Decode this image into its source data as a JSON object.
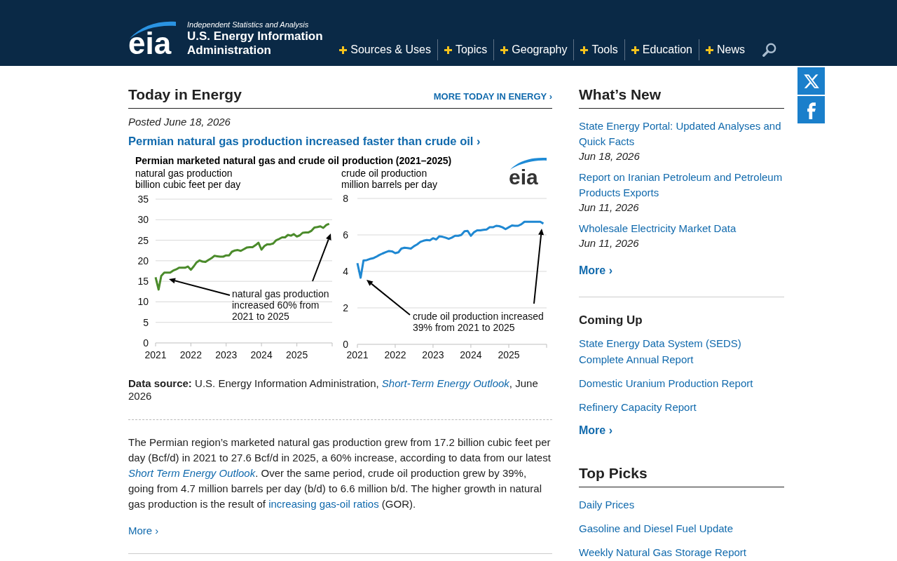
{
  "header": {
    "logo": "eia",
    "tagline": "Independent Statistics and Analysis",
    "org_name": [
      "U.S. Energy Information",
      "Administration"
    ],
    "nav": [
      {
        "label": "Sources & Uses"
      },
      {
        "label": "Topics"
      },
      {
        "label": "Geography"
      },
      {
        "label": "Tools"
      },
      {
        "label": "Education"
      },
      {
        "label": "News"
      }
    ]
  },
  "today": {
    "heading": "Today in Energy",
    "more_link": "MORE TODAY IN ENERGY ›",
    "posted": "Posted June 18, 2026",
    "headline": "Permian natural gas production increased faster than crude oil ›",
    "figure": {
      "title": "Permian marketed natural gas and crude oil production (2021–2025)",
      "logo": "eia",
      "chart_data": [
        {
          "type": "line",
          "ylabel": "natural gas production\nbillion cubic feet per day",
          "x": [
            "2021-01-01",
            "2021-02-01",
            "2021-03-01",
            "2021-04-01",
            "2021-05-01",
            "2021-06-01",
            "2021-07-01",
            "2021-08-01",
            "2021-09-01",
            "2021-10-01",
            "2021-11-01",
            "2021-12-01",
            "2022-01-01",
            "2022-02-01",
            "2022-03-01",
            "2022-04-01",
            "2022-05-01",
            "2022-06-01",
            "2022-07-01",
            "2022-08-01",
            "2022-09-01",
            "2022-10-01",
            "2022-11-01",
            "2022-12-01",
            "2023-01-01",
            "2023-02-01",
            "2023-03-01",
            "2023-04-01",
            "2023-05-01",
            "2023-06-01",
            "2023-07-01",
            "2023-08-01",
            "2023-09-01",
            "2023-10-01",
            "2023-11-01",
            "2023-12-01",
            "2024-01-01",
            "2024-02-01",
            "2024-03-01",
            "2024-04-01",
            "2024-05-01",
            "2024-06-01",
            "2024-07-01",
            "2024-08-01",
            "2024-09-01",
            "2024-10-01",
            "2024-11-01",
            "2024-12-01",
            "2025-01-01",
            "2025-02-01",
            "2025-03-01",
            "2025-04-01",
            "2025-05-01",
            "2025-06-01",
            "2025-07-01",
            "2025-08-01",
            "2025-09-01",
            "2025-10-01",
            "2025-11-01",
            "2025-12-01"
          ],
          "values": [
            16.0,
            13.0,
            16.3,
            17.1,
            17.1,
            17.1,
            17.6,
            17.9,
            18.3,
            18.3,
            18.3,
            18.6,
            17.8,
            18.7,
            19.6,
            20.1,
            19.8,
            19.7,
            20.2,
            20.6,
            21.2,
            21.1,
            21.0,
            21.0,
            21.3,
            21.3,
            22.2,
            22.5,
            22.6,
            22.4,
            22.8,
            23.2,
            23.3,
            23.3,
            23.8,
            24.4,
            22.7,
            23.6,
            24.0,
            24.0,
            24.2,
            25.0,
            25.3,
            25.7,
            25.7,
            26.3,
            26.1,
            26.5,
            25.9,
            26.2,
            26.8,
            26.9,
            26.9,
            27.3,
            28.1,
            28.2,
            28.4,
            28.0,
            28.7,
            29.0
          ],
          "color": "#4b8b2b",
          "xlim": [
            "2021-01-01",
            "2026-01-01"
          ],
          "ylim": [
            0,
            35
          ],
          "yticks": [
            0,
            5,
            10,
            15,
            20,
            25,
            30,
            35
          ],
          "xticks": [
            {
              "value": "2021-01-01",
              "label": "2021"
            },
            {
              "value": "2022-01-01",
              "label": "2022"
            },
            {
              "value": "2023-01-01",
              "label": "2023"
            },
            {
              "value": "2024-01-01",
              "label": "2024"
            },
            {
              "value": "2025-01-01",
              "label": "2025"
            }
          ],
          "grid": "y",
          "annotations": [
            "natural gas production\nincreased 60% from\n2021 to 2025"
          ]
        },
        {
          "type": "line",
          "ylabel": "crude oil production\nmillion barrels per day",
          "x": [
            "2021-01-01",
            "2021-02-01",
            "2021-03-01",
            "2021-04-01",
            "2021-05-01",
            "2021-06-01",
            "2021-07-01",
            "2021-08-01",
            "2021-09-01",
            "2021-10-01",
            "2021-11-01",
            "2021-12-01",
            "2022-01-01",
            "2022-02-01",
            "2022-03-01",
            "2022-04-01",
            "2022-05-01",
            "2022-06-01",
            "2022-07-01",
            "2022-08-01",
            "2022-09-01",
            "2022-10-01",
            "2022-11-01",
            "2022-12-01",
            "2023-01-01",
            "2023-02-01",
            "2023-03-01",
            "2023-04-01",
            "2023-05-01",
            "2023-06-01",
            "2023-07-01",
            "2023-08-01",
            "2023-09-01",
            "2023-10-01",
            "2023-11-01",
            "2023-12-01",
            "2024-01-01",
            "2024-02-01",
            "2024-03-01",
            "2024-04-01",
            "2024-05-01",
            "2024-06-01",
            "2024-07-01",
            "2024-08-01",
            "2024-09-01",
            "2024-10-01",
            "2024-11-01",
            "2024-12-01",
            "2025-01-01",
            "2025-02-01",
            "2025-03-01",
            "2025-04-01",
            "2025-05-01",
            "2025-06-01",
            "2025-07-01",
            "2025-08-01",
            "2025-09-01",
            "2025-10-01",
            "2025-11-01",
            "2025-12-01"
          ],
          "values": [
            4.45,
            3.65,
            4.6,
            4.62,
            4.68,
            4.72,
            4.8,
            4.9,
            4.98,
            5.05,
            5.12,
            5.1,
            5.0,
            5.05,
            5.25,
            5.3,
            5.28,
            5.25,
            5.38,
            5.48,
            5.62,
            5.68,
            5.72,
            5.7,
            5.82,
            5.75,
            5.92,
            5.9,
            5.85,
            5.78,
            5.85,
            5.95,
            5.95,
            6.0,
            6.2,
            6.22,
            5.95,
            6.15,
            6.25,
            6.25,
            6.28,
            6.3,
            6.42,
            6.42,
            6.5,
            6.48,
            6.42,
            6.32,
            6.42,
            6.52,
            6.5,
            6.5,
            6.58,
            6.72,
            6.72,
            6.72,
            6.72,
            6.72,
            6.72,
            6.62
          ],
          "color": "#1f88d2",
          "xlim": [
            "2021-01-01",
            "2026-01-01"
          ],
          "ylim": [
            0,
            8
          ],
          "yticks": [
            0,
            2,
            4,
            6,
            8
          ],
          "xticks": [
            {
              "value": "2021-01-01",
              "label": "2021"
            },
            {
              "value": "2022-01-01",
              "label": "2022"
            },
            {
              "value": "2023-01-01",
              "label": "2023"
            },
            {
              "value": "2024-01-01",
              "label": "2024"
            },
            {
              "value": "2025-01-01",
              "label": "2025"
            }
          ],
          "grid": "y",
          "annotations": [
            "crude oil production increased\n39% from 2021 to 2025"
          ]
        }
      ]
    },
    "source": [
      {
        "kind": "text",
        "text": "**Data source:** U.S. Energy Information Administration, "
      },
      {
        "kind": "link",
        "text": "Short-Term Energy Outlook",
        "italic": true
      },
      {
        "kind": "text",
        "text": ", June 2026"
      }
    ],
    "body": [
      {
        "kind": "text",
        "text": "The Permian region’s marketed natural gas production grew from 17.2 billion cubic feet per day (Bcf/d) in 2021 to 27.6 Bcf/d in 2025, a 60% increase, according to data from our latest "
      },
      {
        "kind": "link",
        "text": "Short Term Energy Outlook",
        "italic": true
      },
      {
        "kind": "text",
        "text": ". Over the same period, crude oil production grew by 39%, going from 4.7 million barrels per day (b/d) to 6.6 million b/d. The higher growth in natural gas production is the result of "
      },
      {
        "kind": "link",
        "text": "increasing gas-oil ratios",
        "italic": false
      },
      {
        "kind": "text",
        "text": " (GOR)."
      }
    ],
    "more": "More ›"
  },
  "whats_new": {
    "heading": "What’s New",
    "items": [
      {
        "title": "State Energy Portal: Updated Analyses and Quick Facts",
        "date": "Jun 18, 2026"
      },
      {
        "title": "Report on Iranian Petroleum and Petroleum Products Exports",
        "date": "Jun 11, 2026"
      },
      {
        "title": "Wholesale Electricity Market Data",
        "date": "Jun 11, 2026"
      }
    ],
    "more": "More ›"
  },
  "coming_up": {
    "heading": "Coming Up",
    "items": [
      {
        "title": "State Energy Data System (SEDS) Complete Annual Report"
      },
      {
        "title": "Domestic Uranium Production Report"
      },
      {
        "title": "Refinery Capacity Report"
      }
    ],
    "more": "More ›"
  },
  "top_picks": {
    "heading": "Top Picks",
    "items": [
      {
        "title": "Daily Prices"
      },
      {
        "title": "Gasoline and Diesel Fuel Update"
      },
      {
        "title": "Weekly Natural Gas Storage Report"
      }
    ]
  }
}
